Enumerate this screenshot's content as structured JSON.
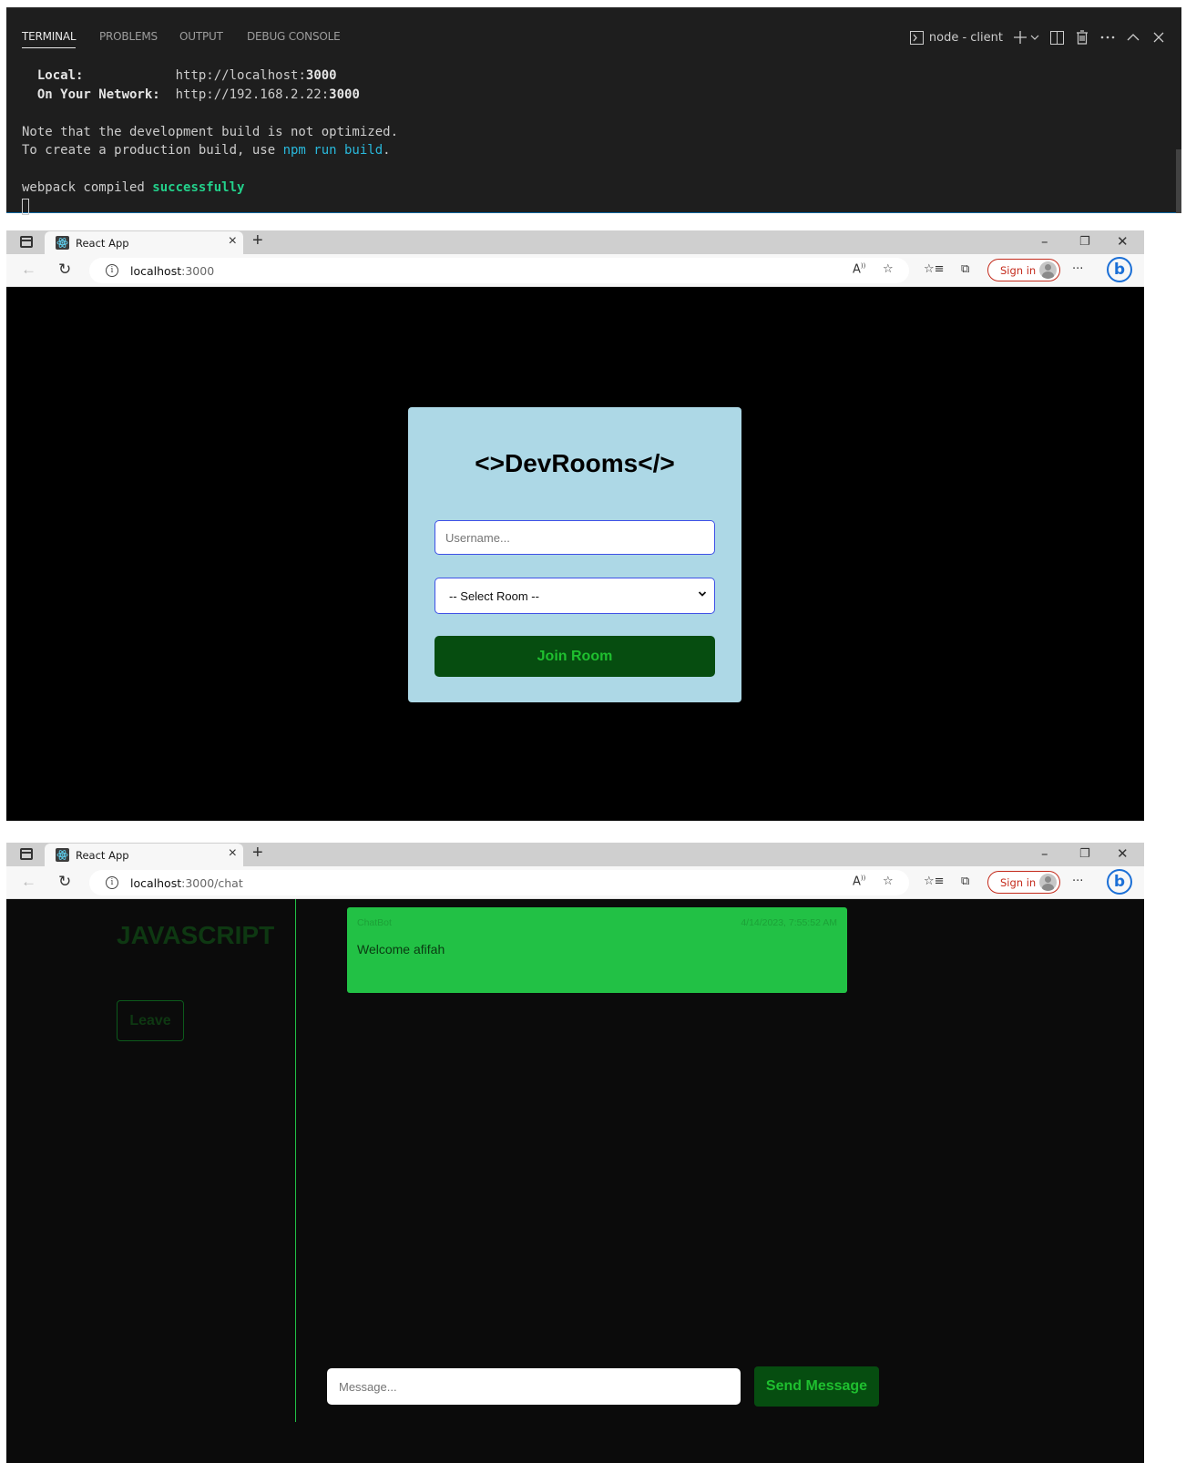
{
  "terminal": {
    "tabs": [
      "TERMINAL",
      "PROBLEMS",
      "OUTPUT",
      "DEBUG CONSOLE"
    ],
    "active_tab": "TERMINAL",
    "shell_label": "node - client",
    "lines": {
      "local_label": "Local:",
      "local_url_prefix": "http://localhost:",
      "local_port": "3000",
      "network_label": "On Your Network:",
      "network_url_prefix": "http://192.168.2.22:",
      "network_port": "3000",
      "note": "Note that the development build is not optimized.",
      "prod_prefix": "To create a production build, use ",
      "prod_cmd": "npm run build",
      "prod_suffix": ".",
      "compiled_prefix": "webpack compiled ",
      "compiled_status": "successfully"
    },
    "icons": [
      "terminal-icon",
      "plus-icon",
      "chevron-down-icon",
      "split-icon",
      "trash-icon",
      "ellipsis-icon",
      "chevron-up-icon",
      "close-icon"
    ]
  },
  "browser1": {
    "tab_title": "React App",
    "url_host": "localhost",
    "url_path": ":3000",
    "signin_label": "Sign in"
  },
  "login": {
    "title": "<>DevRooms</>",
    "username_placeholder": "Username...",
    "room_select_value": "-- Select Room --",
    "join_label": "Join Room"
  },
  "browser2": {
    "tab_title": "React App",
    "url_host": "localhost",
    "url_path": ":3000/chat",
    "signin_label": "Sign in"
  },
  "chat": {
    "room_name": "JAVASCRIPT",
    "leave_label": "Leave",
    "messages": [
      {
        "user": "ChatBot",
        "time": "4/14/2023, 7:55:52 AM",
        "text": "Welcome afifah"
      }
    ],
    "message_placeholder": "Message...",
    "send_label": "Send Message"
  },
  "colors": {
    "terminal_bg": "#1e1e1e",
    "success_green": "#23d18b",
    "command_cyan": "#29b8db",
    "card_bg": "#add8e6",
    "button_dark_green": "#064d10",
    "message_green": "#22c145"
  }
}
